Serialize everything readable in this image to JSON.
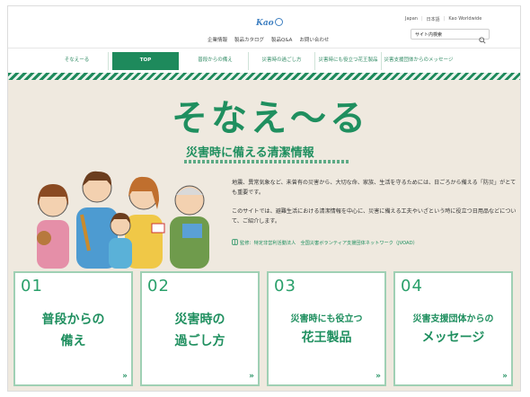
{
  "header": {
    "logo": "Kao",
    "nav": [
      "企業情報",
      "製品カタログ",
      "製品Q&A",
      "お問い合わせ"
    ],
    "util": [
      "Japan",
      "日本語",
      "Kao Worldwide"
    ],
    "search_placeholder": "サイト内検索"
  },
  "sitenav": {
    "brand": "そなえーる",
    "items": [
      {
        "label": "TOP",
        "active": true
      },
      {
        "label": "普段からの備え"
      },
      {
        "label": "災害時の過ごし方"
      },
      {
        "label": "災害時にも役立つ花王製品"
      },
      {
        "label": "災害支援団体からのメッセージ"
      }
    ]
  },
  "hero": {
    "title": "そなえ〜る",
    "subtitle": "災害時に備える清潔情報",
    "desc1": "地震、異常気象など、未曾有の災害から、大切な命、家族、生活を守るためには、日ごろから備える「防災」がとても重要です。",
    "desc2": "このサイトでは、避難生活における清潔情報を中心に、災害に備える工夫やいざという時に役立つ日用品などについて、ご紹介します。",
    "credit": "監修：特定非営利活動法人　全国災害ボランティア支援団体ネットワーク（JVOAD）"
  },
  "cards": [
    {
      "num": "01",
      "line1": "普段からの",
      "line2": "備え"
    },
    {
      "num": "02",
      "line1": "災害時の",
      "line2": "過ごし方"
    },
    {
      "num": "03",
      "line1": "災害時にも役立つ",
      "line2": "花王製品"
    },
    {
      "num": "04",
      "line1": "災害支援団体からの",
      "line2": "メッセージ"
    }
  ],
  "colors": {
    "accent": "#1e8a5c",
    "hero_bg": "#efe9df",
    "card_border": "#9fd0b4"
  },
  "icons": [
    "search-icon",
    "chevron-right-icon",
    "book-icon"
  ]
}
